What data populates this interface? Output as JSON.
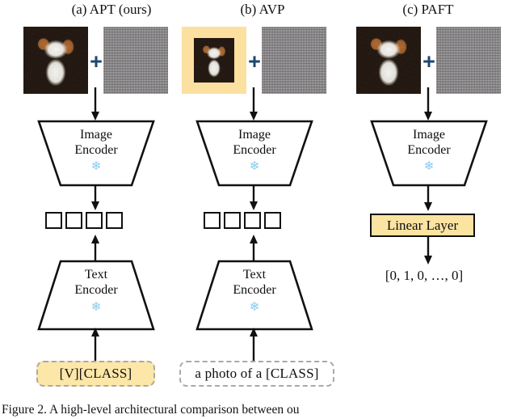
{
  "figure": {
    "caption": "Figure 2.    A high-level architectural comparison between ou",
    "colors": {
      "prompt_yellow": "#fce7a8",
      "linear_layer_yellow": "#fbe3a1",
      "image_pad_yellow": "#fbe0a0",
      "plus_blue": "#20476e",
      "snowflake_blue": "#88c8ee",
      "dashed_border_gray": "#a9a9a9",
      "stroke_black": "#111111"
    }
  },
  "columns": [
    {
      "id": "apt",
      "header": "(a) APT (ours)",
      "inputs": {
        "image_alt": "dog-photo",
        "image_padded": false,
        "plus": "+",
        "noise_alt": "noise-patch"
      },
      "image_encoder": {
        "line1": "Image",
        "line2": "Encoder",
        "frozen_icon": "snowflake-icon",
        "frozen_glyph": "❄"
      },
      "tokens": {
        "count": 4,
        "label": "embedding-tokens"
      },
      "text_encoder": {
        "line1": "Text",
        "line2": "Encoder",
        "frozen_icon": "snowflake-icon",
        "frozen_glyph": "❄"
      },
      "prompt": {
        "text": "[V][CLASS]",
        "style": "yellow-dashed"
      },
      "has_linear_layer": false,
      "has_text_branch": true
    },
    {
      "id": "avp",
      "header": "(b) AVP",
      "inputs": {
        "image_alt": "dog-photo",
        "image_padded": true,
        "plus": "+",
        "noise_alt": "noise-patch"
      },
      "image_encoder": {
        "line1": "Image",
        "line2": "Encoder",
        "frozen_icon": "snowflake-icon",
        "frozen_glyph": "❄"
      },
      "tokens": {
        "count": 4,
        "label": "embedding-tokens"
      },
      "text_encoder": {
        "line1": "Text",
        "line2": "Encoder",
        "frozen_icon": "snowflake-icon",
        "frozen_glyph": "❄"
      },
      "prompt": {
        "text": "a photo of a [CLASS]",
        "style": "plain-dashed"
      },
      "has_linear_layer": false,
      "has_text_branch": true
    },
    {
      "id": "paft",
      "header": "(c) PAFT",
      "inputs": {
        "image_alt": "dog-photo",
        "image_padded": false,
        "plus": "+",
        "noise_alt": "noise-patch"
      },
      "image_encoder": {
        "line1": "Image",
        "line2": "Encoder",
        "frozen_icon": "snowflake-icon",
        "frozen_glyph": "❄"
      },
      "linear_layer": {
        "label": "Linear Layer"
      },
      "output": {
        "text": "[0, 1, 0, …, 0]"
      },
      "has_linear_layer": true,
      "has_text_branch": false
    }
  ]
}
